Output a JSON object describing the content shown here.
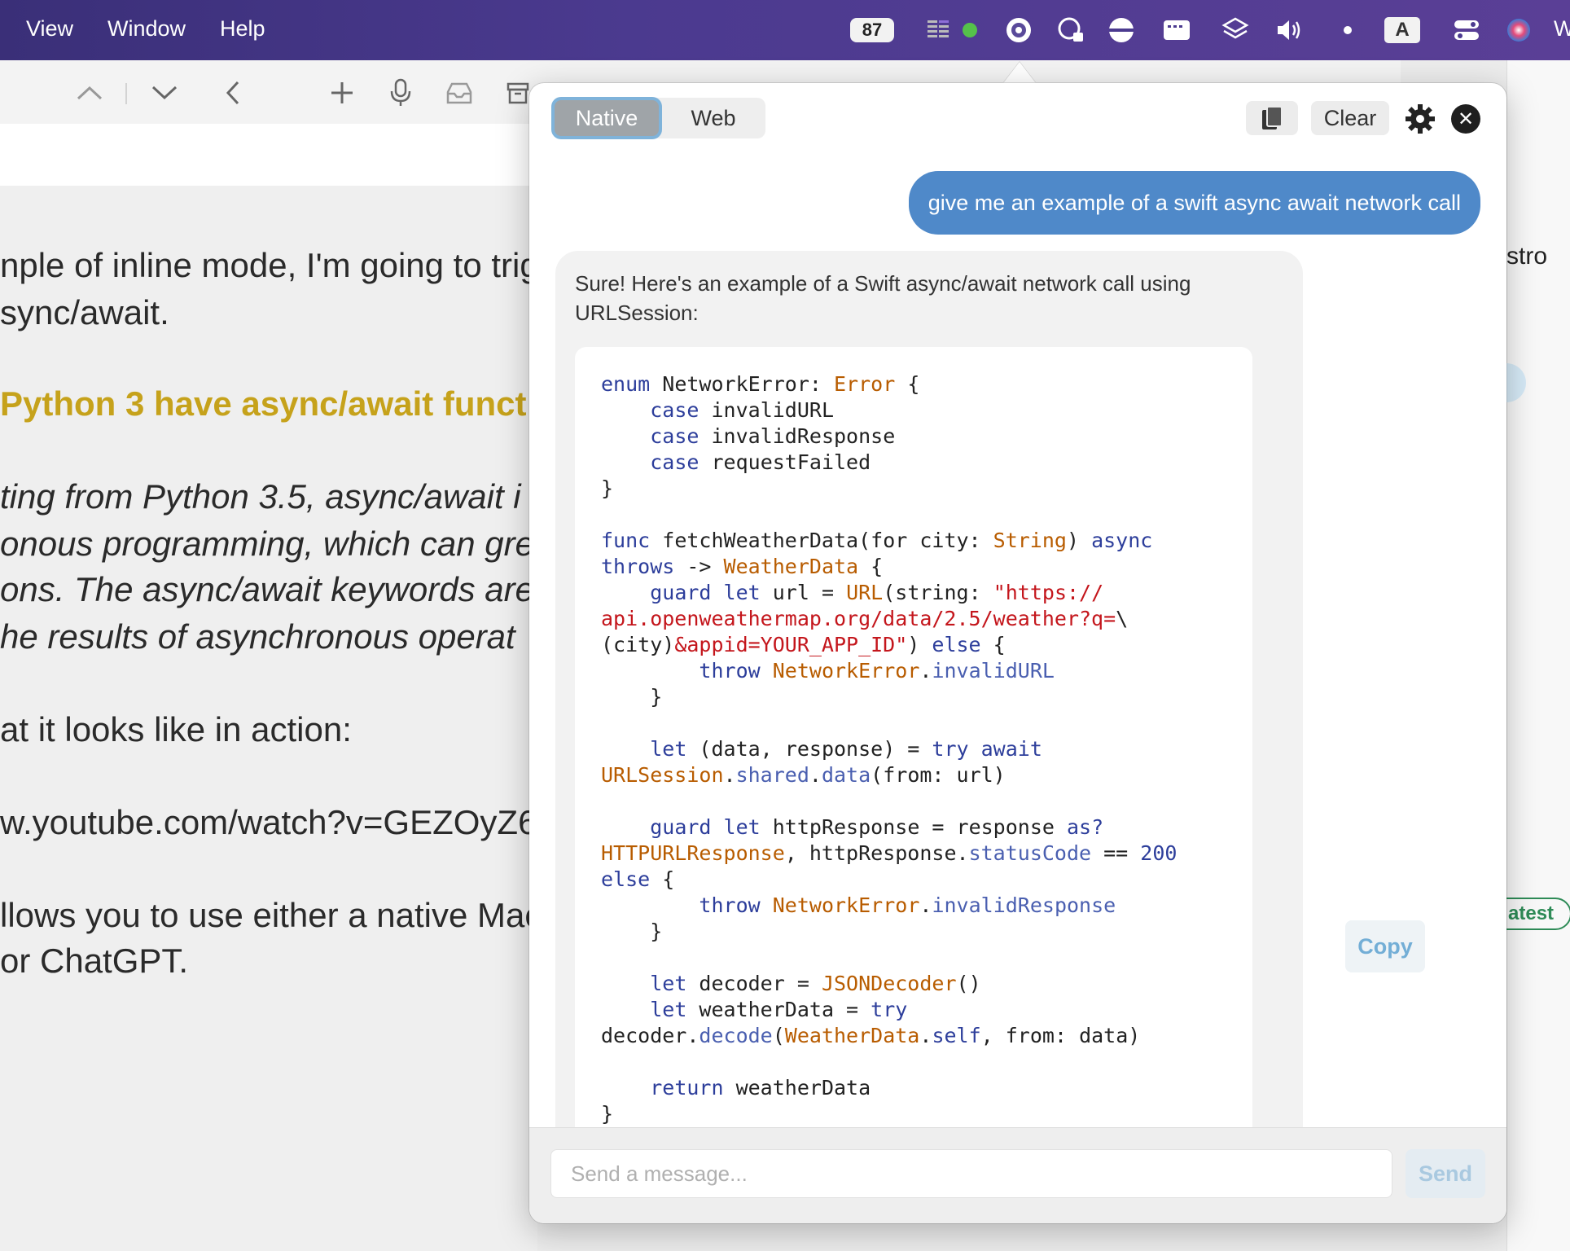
{
  "menubar": {
    "items": [
      "View",
      "Window",
      "Help"
    ],
    "battery_value": "87",
    "input_source": "A",
    "trailing_label": "W"
  },
  "background_doc": {
    "lines": [
      "nple of inline mode, I'm going to trig",
      "sync/await.",
      "Python 3 have async/await funct",
      "ting from Python 3.5, async/await i",
      "onous programming, which can gre",
      "ons. The async/await keywords are",
      "he results of asynchronous operat",
      "at it looks like in action:",
      "w.youtube.com/watch?v=GEZOyZ6",
      "llows you to use either a native Mac",
      "or ChatGPT."
    ],
    "right_fragment": "stro",
    "right_badge": "atest"
  },
  "popover": {
    "mode_tabs": {
      "native": "Native",
      "web": "Web"
    },
    "clear_label": "Clear",
    "user_message": "give me an example of a swift async await network call",
    "assistant_intro": "Sure! Here's an example of a Swift async/await network call using URLSession:",
    "copy_label": "Copy",
    "input_placeholder": "Send a message...",
    "send_label": "Send"
  }
}
